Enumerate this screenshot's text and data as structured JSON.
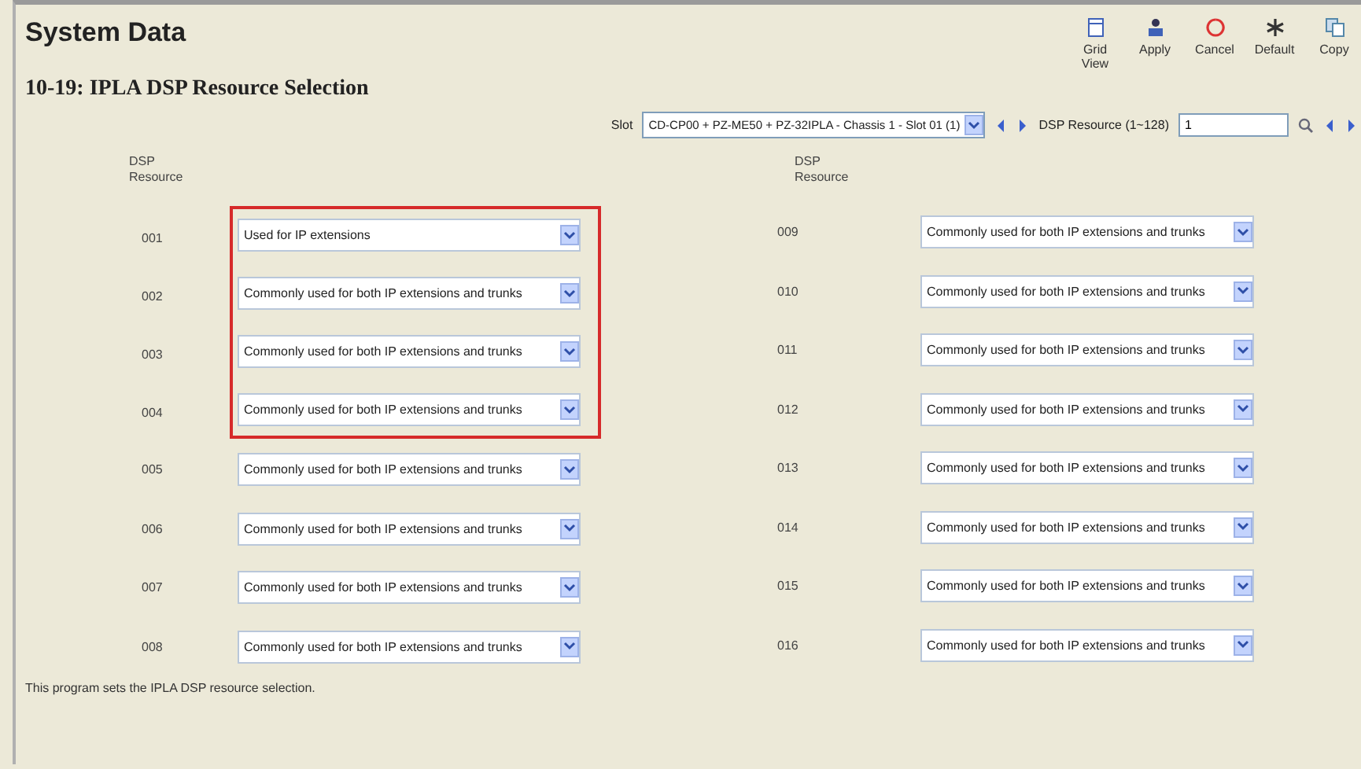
{
  "title": "System Data",
  "toolbar": [
    {
      "kind": "grid",
      "label": "Grid View"
    },
    {
      "kind": "apply",
      "label": "Apply"
    },
    {
      "kind": "cancel",
      "label": "Cancel"
    },
    {
      "kind": "default",
      "label": "Default"
    },
    {
      "kind": "copy",
      "label": "Copy"
    }
  ],
  "program_title": "10-19: IPLA DSP Resource Selection",
  "slot": {
    "label": "Slot",
    "value": "CD-CP00 + PZ-ME50 + PZ-32IPLA - Chassis 1 - Slot 01 (1)"
  },
  "resource": {
    "label": "DSP Resource (1~128)",
    "value": "1"
  },
  "columns": [
    {
      "header": "DSP Resource",
      "rows": [
        {
          "id": "001",
          "value": "Used for IP extensions",
          "highlighted": true
        },
        {
          "id": "002",
          "value": "Commonly used for both IP extensions and trunks",
          "highlighted": true
        },
        {
          "id": "003",
          "value": "Commonly used for both IP extensions and trunks",
          "highlighted": true
        },
        {
          "id": "004",
          "value": "Commonly used for both IP extensions and trunks",
          "highlighted": true
        },
        {
          "id": "005",
          "value": "Commonly used for both IP extensions and trunks",
          "highlighted": false
        },
        {
          "id": "006",
          "value": "Commonly used for both IP extensions and trunks",
          "highlighted": false
        },
        {
          "id": "007",
          "value": "Commonly used for both IP extensions and trunks",
          "highlighted": false
        },
        {
          "id": "008",
          "value": "Commonly used for both IP extensions and trunks",
          "highlighted": false
        }
      ]
    },
    {
      "header": "DSP Resource",
      "rows": [
        {
          "id": "009",
          "value": "Commonly used for both IP extensions and trunks",
          "highlighted": false
        },
        {
          "id": "010",
          "value": "Commonly used for both IP extensions and trunks",
          "highlighted": false
        },
        {
          "id": "011",
          "value": "Commonly used for both IP extensions and trunks",
          "highlighted": false
        },
        {
          "id": "012",
          "value": "Commonly used for both IP extensions and trunks",
          "highlighted": false
        },
        {
          "id": "013",
          "value": "Commonly used for both IP extensions and trunks",
          "highlighted": false
        },
        {
          "id": "014",
          "value": "Commonly used for both IP extensions and trunks",
          "highlighted": false
        },
        {
          "id": "015",
          "value": "Commonly used for both IP extensions and trunks",
          "highlighted": false
        },
        {
          "id": "016",
          "value": "Commonly used for both IP extensions and trunks",
          "highlighted": false
        }
      ]
    }
  ],
  "description": "This program sets the IPLA DSP resource selection."
}
